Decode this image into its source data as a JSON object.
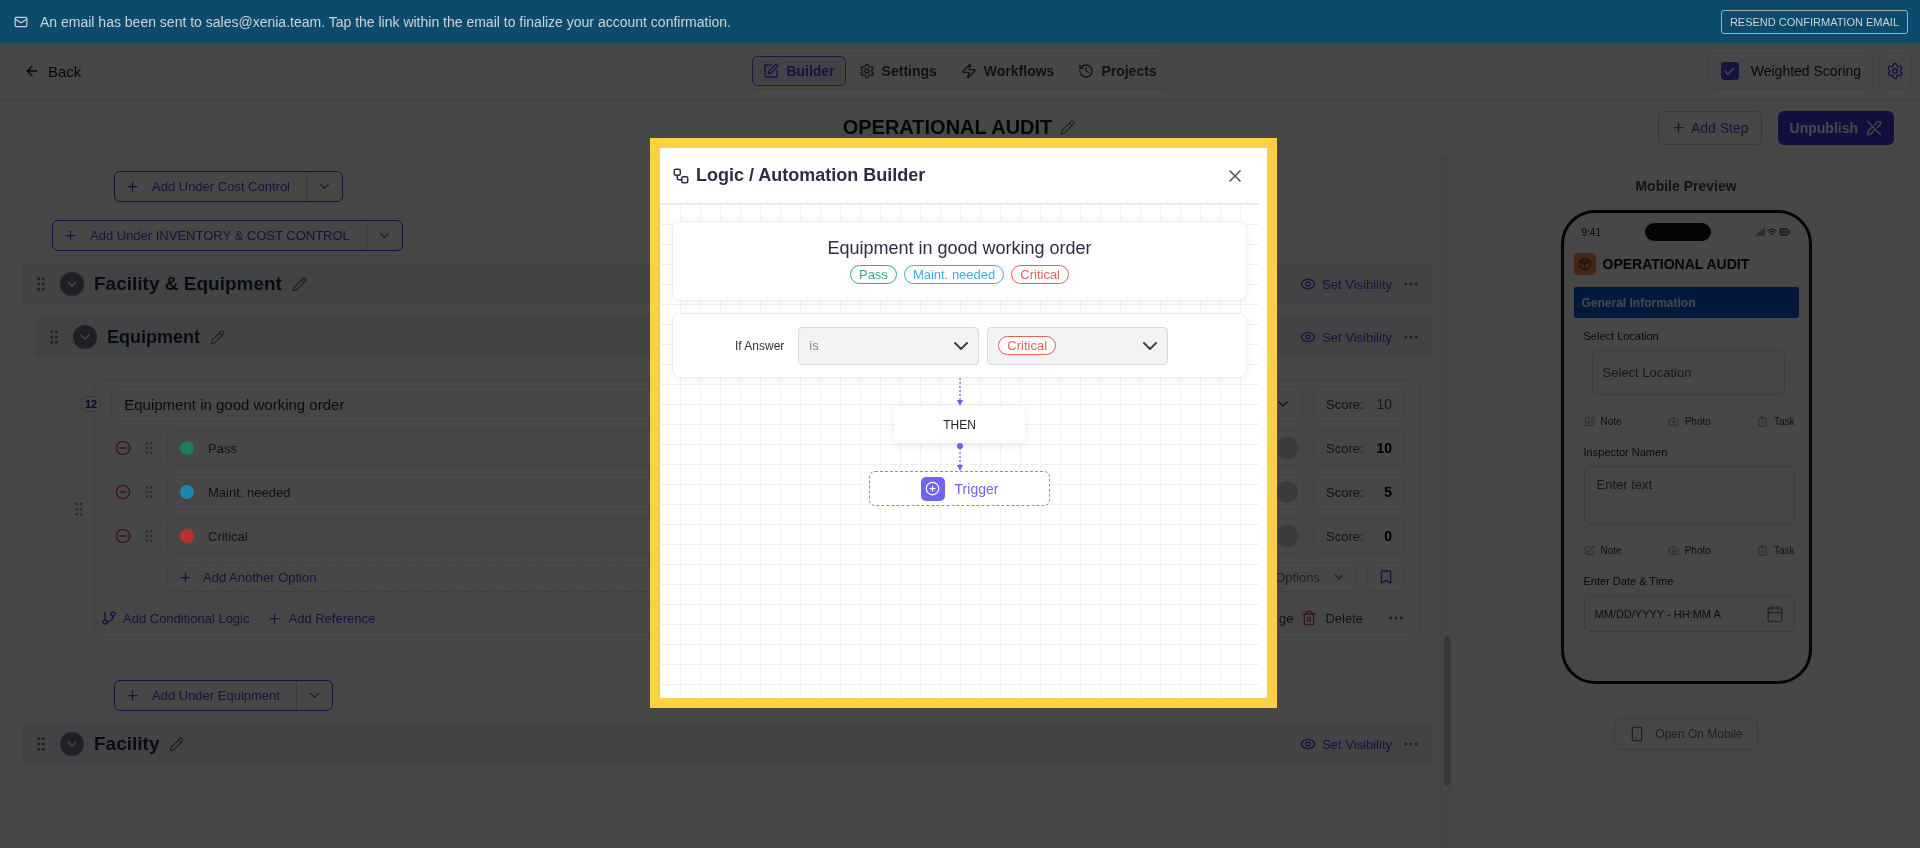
{
  "banner": {
    "message": "An email has been sent to sales@xenia.team. Tap the link within the email to finalize your account confirmation.",
    "action": "RESEND CONFIRMATION EMAIL"
  },
  "header": {
    "back": "Back",
    "tabs": [
      {
        "label": "Builder",
        "selected": true
      },
      {
        "label": "Settings",
        "selected": false
      },
      {
        "label": "Workflows",
        "selected": false
      },
      {
        "label": "Projects",
        "selected": false
      }
    ],
    "weighted_scoring": {
      "label": "Weighted Scoring",
      "checked": true
    }
  },
  "title": "OPERATIONAL AUDIT",
  "title_actions": {
    "add_step": "Add Step",
    "unpublish": "Unpublish"
  },
  "builder": {
    "add_buttons": [
      {
        "kind": "nested",
        "label": "Add Under Cost Control"
      },
      {
        "kind": "outer",
        "label": "Add Under INVENTORY & COST CONTROL"
      }
    ],
    "sections": [
      {
        "title": "Facility & Equipment",
        "visibility": "Set Visibility",
        "subsections": [
          {
            "title": "Equipment",
            "visibility": "Set Visibility",
            "question": {
              "number": "12",
              "text": "Equipment in good working order",
              "score_label": "Score:",
              "score_placeholder": "10",
              "options": [
                {
                  "label": "Pass",
                  "score_label": "Score:",
                  "color": "#1b7a62",
                  "score": "10"
                },
                {
                  "label": "Maint. needed",
                  "score_label": "Score:",
                  "color": "#1c85b0",
                  "score": "5"
                },
                {
                  "label": "Critical",
                  "score_label": "Score:",
                  "color": "#b8302c",
                  "score": "0"
                }
              ],
              "add_option": "Add Another Option",
              "options_menu": "Options",
              "conditional_logic": "Add Conditional Logic",
              "reference": "Add Reference",
              "cut_action": "ge",
              "delete": "Delete"
            },
            "add_button": "Add Under Equipment"
          }
        ]
      },
      {
        "title": "Facility",
        "visibility": "Set Visibility"
      }
    ]
  },
  "mobile_preview": {
    "heading": "Mobile Preview",
    "time": "9:41",
    "app_title": "OPERATIONAL AUDIT",
    "section": "General Information",
    "fields": [
      {
        "kind": "select",
        "label": "Select Location",
        "placeholder": "Select Location",
        "actions": [
          "Note",
          "Photo",
          "Task"
        ]
      },
      {
        "kind": "text",
        "label": "Inspector Namen",
        "placeholder": "Enter text",
        "actions": [
          "Note",
          "Photo",
          "Task"
        ]
      },
      {
        "kind": "datetime",
        "label": "Enter Date & Time",
        "placeholder": "MM/DD/YYYY - HH:MM A"
      }
    ],
    "open_button": "Open On Mobile"
  },
  "modal": {
    "title": "Logic / Automation Builder",
    "question": "Equipment in good working order",
    "answers": [
      {
        "label": "Pass",
        "color": "#3aa890"
      },
      {
        "label": "Maint. needed",
        "color": "#3ab0e0"
      },
      {
        "label": "Critical",
        "color": "#e0625c"
      }
    ],
    "condition": {
      "label": "If Answer",
      "operator": "is",
      "value": {
        "label": "Critical",
        "color": "#e0625c"
      }
    },
    "then": "THEN",
    "trigger": "Trigger"
  }
}
